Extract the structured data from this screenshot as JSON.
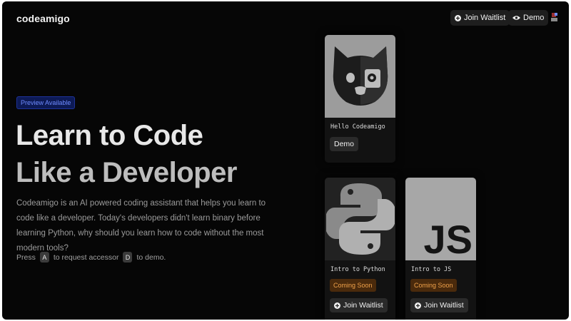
{
  "header": {
    "logo": "codeamigo",
    "join_waitlist": "Join Waitlist",
    "demo": "Demo"
  },
  "hero": {
    "badge": "Preview Available",
    "headline_line1": "Learn to Code",
    "headline_line2": "Like a Developer",
    "description": "Codeamigo is an AI powered coding assistant that helps you learn to code like a developer. Today's developers didn't learn binary before learning Python, why should you learn how to code without the most modern tools?",
    "shortcut": {
      "press": "Press",
      "key_a": "A",
      "middle": "to request accessor",
      "key_d": "D",
      "end": "to demo."
    }
  },
  "cards": [
    {
      "title": "Hello Codeamigo",
      "button": "Demo",
      "image": "dog-robot-logo"
    },
    {
      "title": "Intro to Python",
      "status": "Coming Soon",
      "button": "Join Waitlist",
      "image": "python-logo"
    },
    {
      "title": "Intro to JS",
      "status": "Coming Soon",
      "button": "Join Waitlist",
      "image": "js-logo"
    }
  ],
  "colors": {
    "background": "#060606",
    "badge_text": "#6f8cff",
    "coming_soon_bg": "#4a2a0c",
    "coming_soon_text": "#f0a24a"
  }
}
